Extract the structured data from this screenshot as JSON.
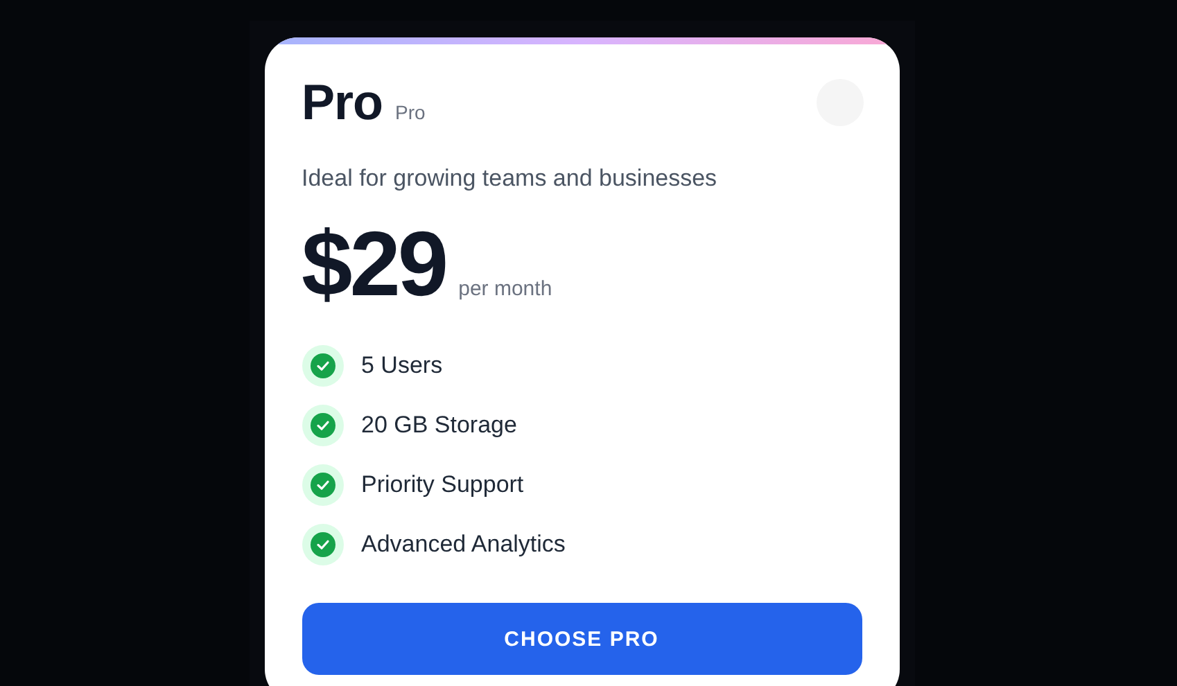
{
  "plan": {
    "name": "Pro",
    "badge": "Pro",
    "description": "Ideal for growing teams and businesses",
    "price": "$29",
    "period": "per month",
    "features": [
      {
        "label": "5 Users",
        "included": true
      },
      {
        "label": "20 GB Storage",
        "included": true
      },
      {
        "label": "Priority Support",
        "included": true
      },
      {
        "label": "Advanced Analytics",
        "included": true
      }
    ],
    "button": "CHOOSE PRO"
  }
}
